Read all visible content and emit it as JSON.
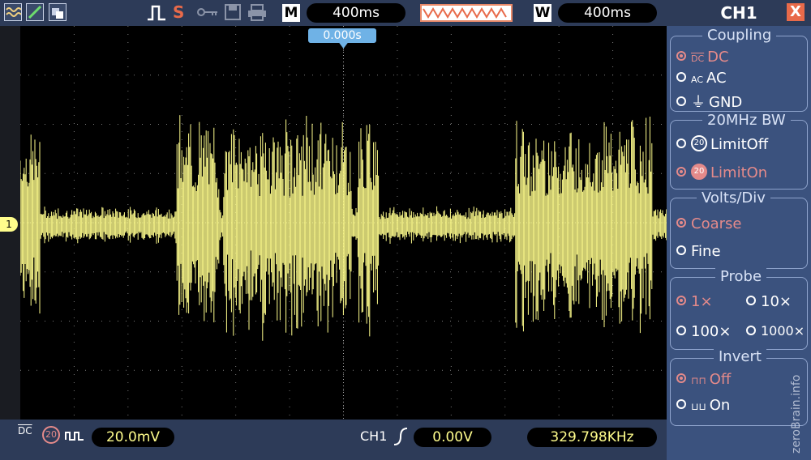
{
  "topbar": {
    "run_state": "S",
    "mode_label": "M",
    "timebase": "400ms",
    "window_label": "W",
    "window_timebase": "400ms"
  },
  "screen": {
    "trigger_time": "0.000s",
    "channel_marker": "1",
    "trace_color": "#fffd8c",
    "background": "#000000"
  },
  "bottombar": {
    "coupling_text": "DC",
    "bw_text": "20",
    "volts_div": "20.0mV",
    "trigger_source": "CH1",
    "trigger_level": "0.00V",
    "frequency": "329.798KHz"
  },
  "panel": {
    "title": "CH1",
    "close_label": "X",
    "coupling": {
      "title": "Coupling",
      "options": [
        "DC",
        "AC",
        "GND"
      ],
      "selected": "DC"
    },
    "bw": {
      "title": "20MHz BW",
      "options": [
        "LimitOff",
        "LimitOn"
      ],
      "selected": "LimitOn",
      "icon_text": "20"
    },
    "volts": {
      "title": "Volts/Div",
      "options": [
        "Coarse",
        "Fine"
      ],
      "selected": "Coarse"
    },
    "probe": {
      "title": "Probe",
      "options": [
        "1×",
        "10×",
        "100×",
        "1000×"
      ],
      "selected": "1×"
    },
    "invert": {
      "title": "Invert",
      "options": [
        "Off",
        "On"
      ],
      "selected": "Off"
    }
  },
  "watermark": "zeroBrain.info",
  "colors": {
    "accent": "#e48a8a",
    "panel": "#3b527e",
    "bar": "#2d3b58",
    "trace": "#fffd8c"
  }
}
